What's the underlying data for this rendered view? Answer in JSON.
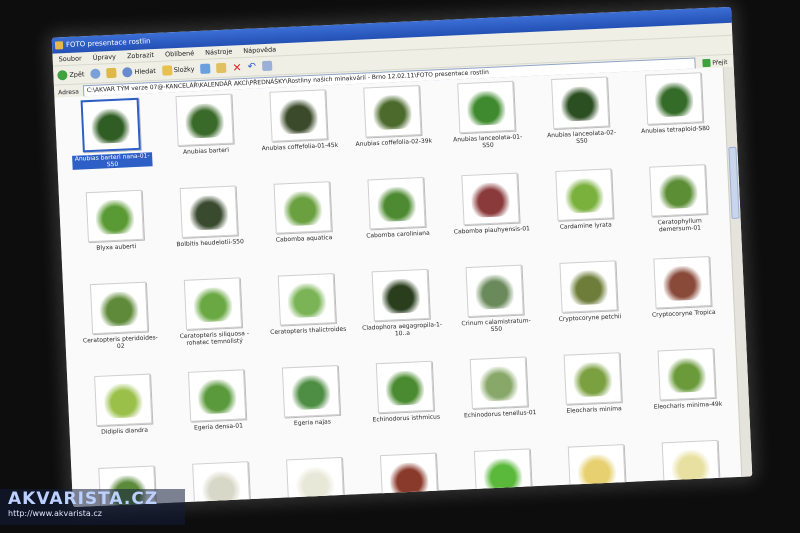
{
  "window": {
    "title": "FOTO presentace rostlin"
  },
  "menu": [
    "Soubor",
    "Úpravy",
    "Zobrazit",
    "Oblíbené",
    "Nástroje",
    "Nápověda"
  ],
  "toolbar": {
    "back_label": "Zpět",
    "search_label": "Hledat",
    "folders_label": "Složky"
  },
  "address": {
    "label": "Adresa",
    "value": "C:\\AKVAR TÝM verze 07@-KANCELÁŘ\\KALENDÁŘ AKCÍ\\PŘEDNÁŠKY\\Rostliny našich minakvárií - Brno 12.02.11\\FOTO presentace rostlin",
    "go_label": "Přejít"
  },
  "items": [
    {
      "caption": "Anubias barteri nana-01-S50",
      "color": "#2f5d24",
      "selected": true
    },
    {
      "caption": "Anubias barteri",
      "color": "#3a6a2a"
    },
    {
      "caption": "Anubias coffefolia-01-45k",
      "color": "#3b4a2a"
    },
    {
      "caption": "Anubias coffefolia-02-39k",
      "color": "#4c6a2c"
    },
    {
      "caption": "Anubias lanceolata-01-S50",
      "color": "#3f8a2e"
    },
    {
      "caption": "Anubias lanceolata-02-S50",
      "color": "#2c4f22"
    },
    {
      "caption": "Anubias tetraploid-S80",
      "color": "#356b28"
    },
    {
      "caption": "Blyxa auberti",
      "color": "#5a9a34"
    },
    {
      "caption": "Bolbitis heudelotii-S50",
      "color": "#3a4a2e"
    },
    {
      "caption": "Cabomba aquatica",
      "color": "#6aa040"
    },
    {
      "caption": "Cabomba caroliniana",
      "color": "#4e8a32"
    },
    {
      "caption": "Cabomba piauhyensis-01",
      "color": "#8a3a3a"
    },
    {
      "caption": "Cardamine lyrata",
      "color": "#7ab03c"
    },
    {
      "caption": "Ceratophyllum demersum-01",
      "color": "#5c8e36"
    },
    {
      "caption": "Ceratopteris pteridoides-02",
      "color": "#5e8a3a"
    },
    {
      "caption": "Ceratopteris siliquosa - rohatec temnolistý",
      "color": "#6aa844"
    },
    {
      "caption": "Ceratopteris thalictroides",
      "color": "#7ab456"
    },
    {
      "caption": "Cladophora aegagropila-1-10..a",
      "color": "#2a3e1e"
    },
    {
      "caption": "Crinum calamistratum-S50",
      "color": "#6a8a5c"
    },
    {
      "caption": "Cryptocoryne petchii",
      "color": "#6e7d3a"
    },
    {
      "caption": "Cryptocoryne Tropica",
      "color": "#8a4a3a"
    },
    {
      "caption": "Didiplis diandra",
      "color": "#9ac04a"
    },
    {
      "caption": "Egeria densa-01",
      "color": "#5a9a3c"
    },
    {
      "caption": "Egeria najas",
      "color": "#4e8e44"
    },
    {
      "caption": "Echinodorus isthmicus",
      "color": "#4a8a30"
    },
    {
      "caption": "Echinodorus tenellus-01",
      "color": "#88a86a"
    },
    {
      "caption": "Eleocharis minima",
      "color": "#7aa040"
    },
    {
      "caption": "Eleocharis minima-49k",
      "color": "#6a9a3a"
    },
    {
      "caption": "",
      "color": "#5a8a3a"
    },
    {
      "caption": "",
      "color": "#d8d8c8"
    },
    {
      "caption": "",
      "color": "#e8e8d8"
    },
    {
      "caption": "",
      "color": "#8a3a2a"
    },
    {
      "caption": "",
      "color": "#5ab83a"
    },
    {
      "caption": "",
      "color": "#e6d070"
    },
    {
      "caption": "",
      "color": "#e8e0a0"
    }
  ],
  "watermark": {
    "title": "AKVARISTA.CZ",
    "url": "http://www.akvarista.cz"
  }
}
